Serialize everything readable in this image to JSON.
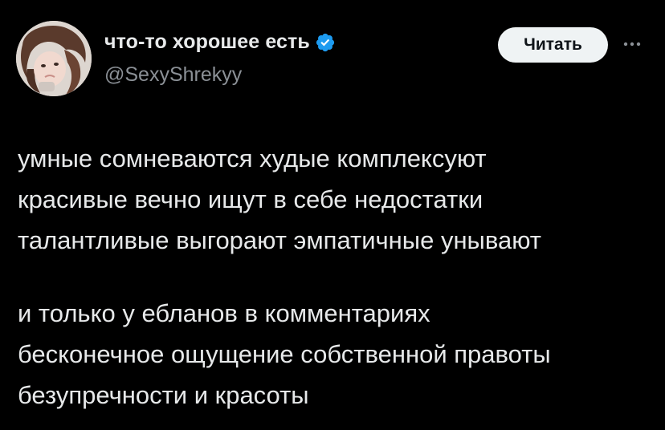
{
  "author": {
    "display_name": "что-то хорошее есть",
    "handle": "@SexyShrekyy",
    "verified": true,
    "verified_color": "#1d9bf0"
  },
  "actions": {
    "follow_label": "Читать",
    "more_icon": "more-horizontal-icon"
  },
  "tweet": {
    "paragraphs": [
      [
        "умные сомневаются худые комплексуют",
        "красивые вечно ищут в себе недостатки",
        "талантливые выгорают эмпатичные унывают"
      ],
      [
        "и только у ебланов в комментариях",
        "бесконечное ощущение собственной правоты",
        "безупречности и красоты"
      ]
    ]
  },
  "colors": {
    "background": "#000000",
    "text": "#e7e9ea",
    "secondary_text": "#8b9096",
    "button_bg": "#eff3f4",
    "button_text": "#0f1419"
  }
}
